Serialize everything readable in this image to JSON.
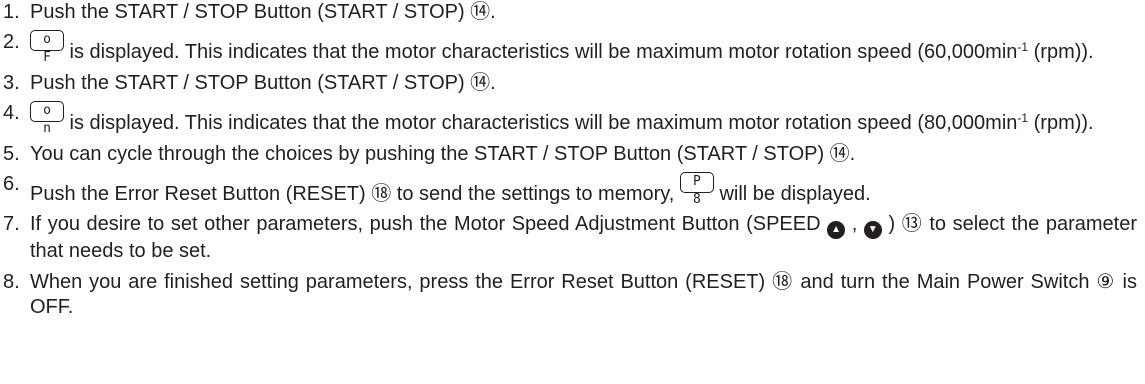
{
  "steps": [
    {
      "num": "1.",
      "text": "Push the START / STOP Button (START / STOP) ⑭."
    },
    {
      "num": "2.",
      "display": "o F",
      "t1": " is displayed. This indicates that the motor characteristics will be maximum motor rotation speed (60,000min",
      "sup": "-1",
      "t2": " (rpm))."
    },
    {
      "num": "3.",
      "text": "Push the START / STOP Button (START / STOP) ⑭."
    },
    {
      "num": "4.",
      "display": "o n",
      "t1": " is displayed. This indicates that the motor characteristics will be maximum motor rotation speed (80,000min",
      "sup": "-1",
      "t2": " (rpm))."
    },
    {
      "num": "5.",
      "text": "You can cycle through the choices by pushing the START / STOP Button (START / STOP) ⑭."
    },
    {
      "num": "6.",
      "t1": "Push the Error Reset Button (RESET) ⑱ to send the settings to memory, ",
      "display": "P 8",
      "t2": " will be displayed."
    },
    {
      "num": "7.",
      "t1": "If you desire to set other parameters, push the Motor Speed Adjustment Button (SPEED ",
      "up_icon": "up-arrow-circle-icon",
      "sep": " , ",
      "down_icon": "down-arrow-circle-icon",
      "t2": " ) ⑬ to select the parameter that needs to be set."
    },
    {
      "num": "8.",
      "text": "When you are finished setting parameters, press the Error Reset Button (RESET) ⑱ and turn the Main Power Switch ⑨ is OFF."
    }
  ]
}
